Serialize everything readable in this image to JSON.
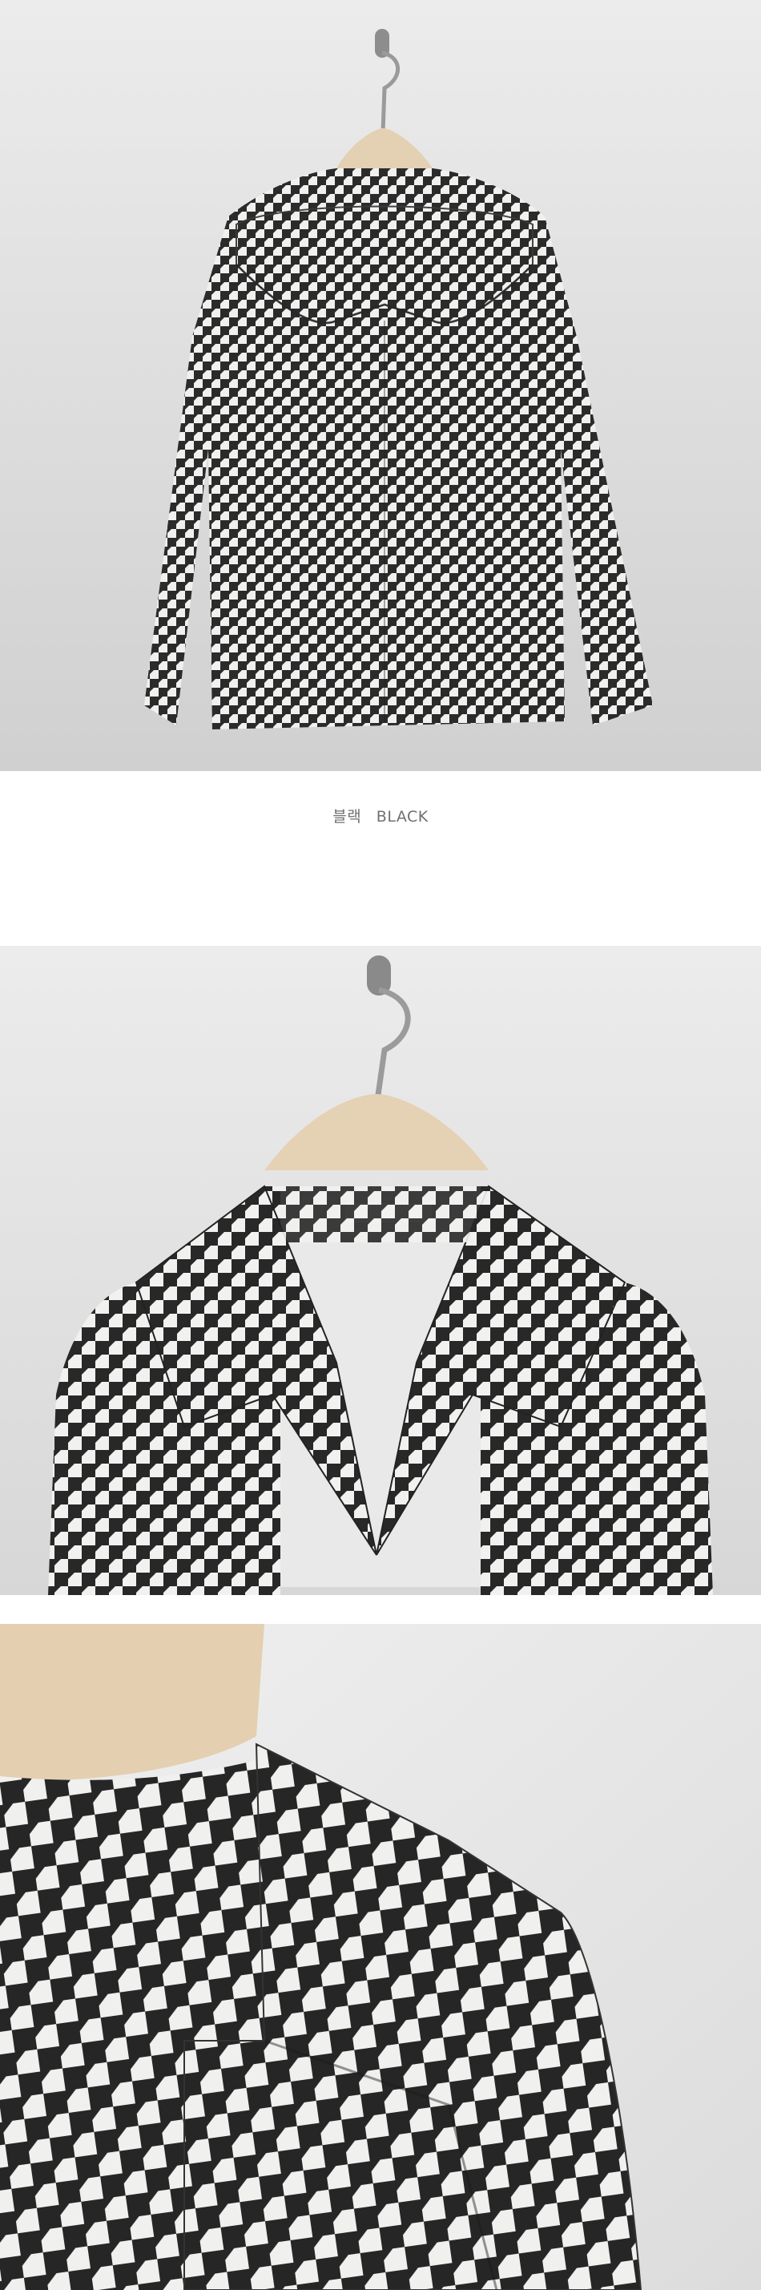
{
  "caption": {
    "korean": "블랙",
    "english": "BLACK"
  },
  "product": {
    "color_name": "black",
    "pattern": "houndstooth",
    "colors": {
      "background_top": "#e8e8e8",
      "background_bottom": "#cfcfcf",
      "pattern_dark": "#2a2a2a",
      "pattern_light": "#f2f2f0",
      "hanger_wood": "#e6d2b5",
      "hanger_hook": "#9a9a9a",
      "lining": "#e9e9e9",
      "caption_text": "#707070"
    }
  },
  "images": [
    {
      "view": "back",
      "icon": "jacket-back-image"
    },
    {
      "view": "front-collar",
      "icon": "jacket-collar-image"
    },
    {
      "view": "closeup",
      "icon": "fabric-closeup-image"
    }
  ]
}
